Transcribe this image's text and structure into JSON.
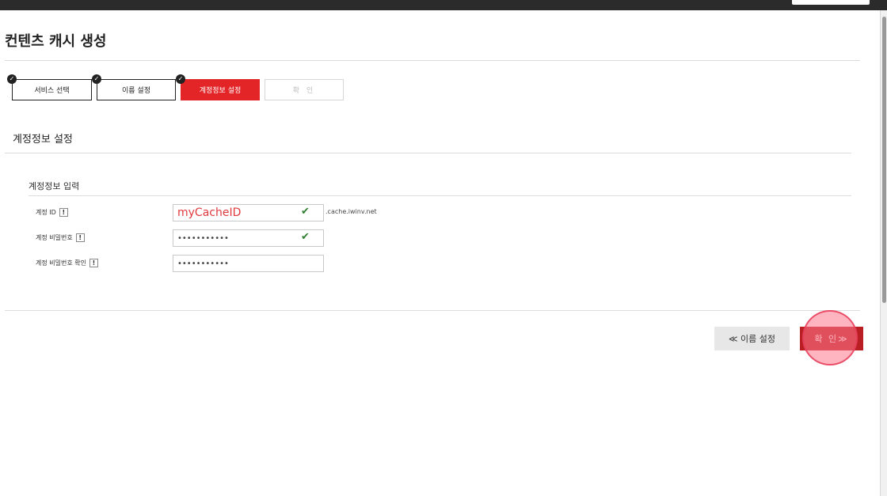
{
  "page": {
    "title": "컨텐츠 캐시 생성"
  },
  "steps": [
    {
      "label": "서비스 선택",
      "state": "done"
    },
    {
      "label": "이름 설정",
      "state": "done"
    },
    {
      "label": "계정정보 설정",
      "state": "active"
    },
    {
      "label": "확 인",
      "state": "pending"
    }
  ],
  "section": {
    "title": "계정정보 설정",
    "subtitle": "계정정보 입력"
  },
  "form": {
    "account_id": {
      "label": "계정 ID",
      "value": "myCacheID",
      "suffix": ".cache.iwinv.net"
    },
    "password": {
      "label": "계정 비밀번호",
      "value": "•••••••••••"
    },
    "password_confirm": {
      "label": "계정 비밀번호 확인",
      "value": "•••••••••••"
    },
    "info_glyph": "!",
    "valid_glyph": "✔"
  },
  "buttons": {
    "prev_label": "≪ 이름 설정",
    "confirm_label": "확 인≫"
  },
  "colors": {
    "accent": "#e42528",
    "confirm": "#b81e22",
    "valid": "#2f7d2f"
  }
}
